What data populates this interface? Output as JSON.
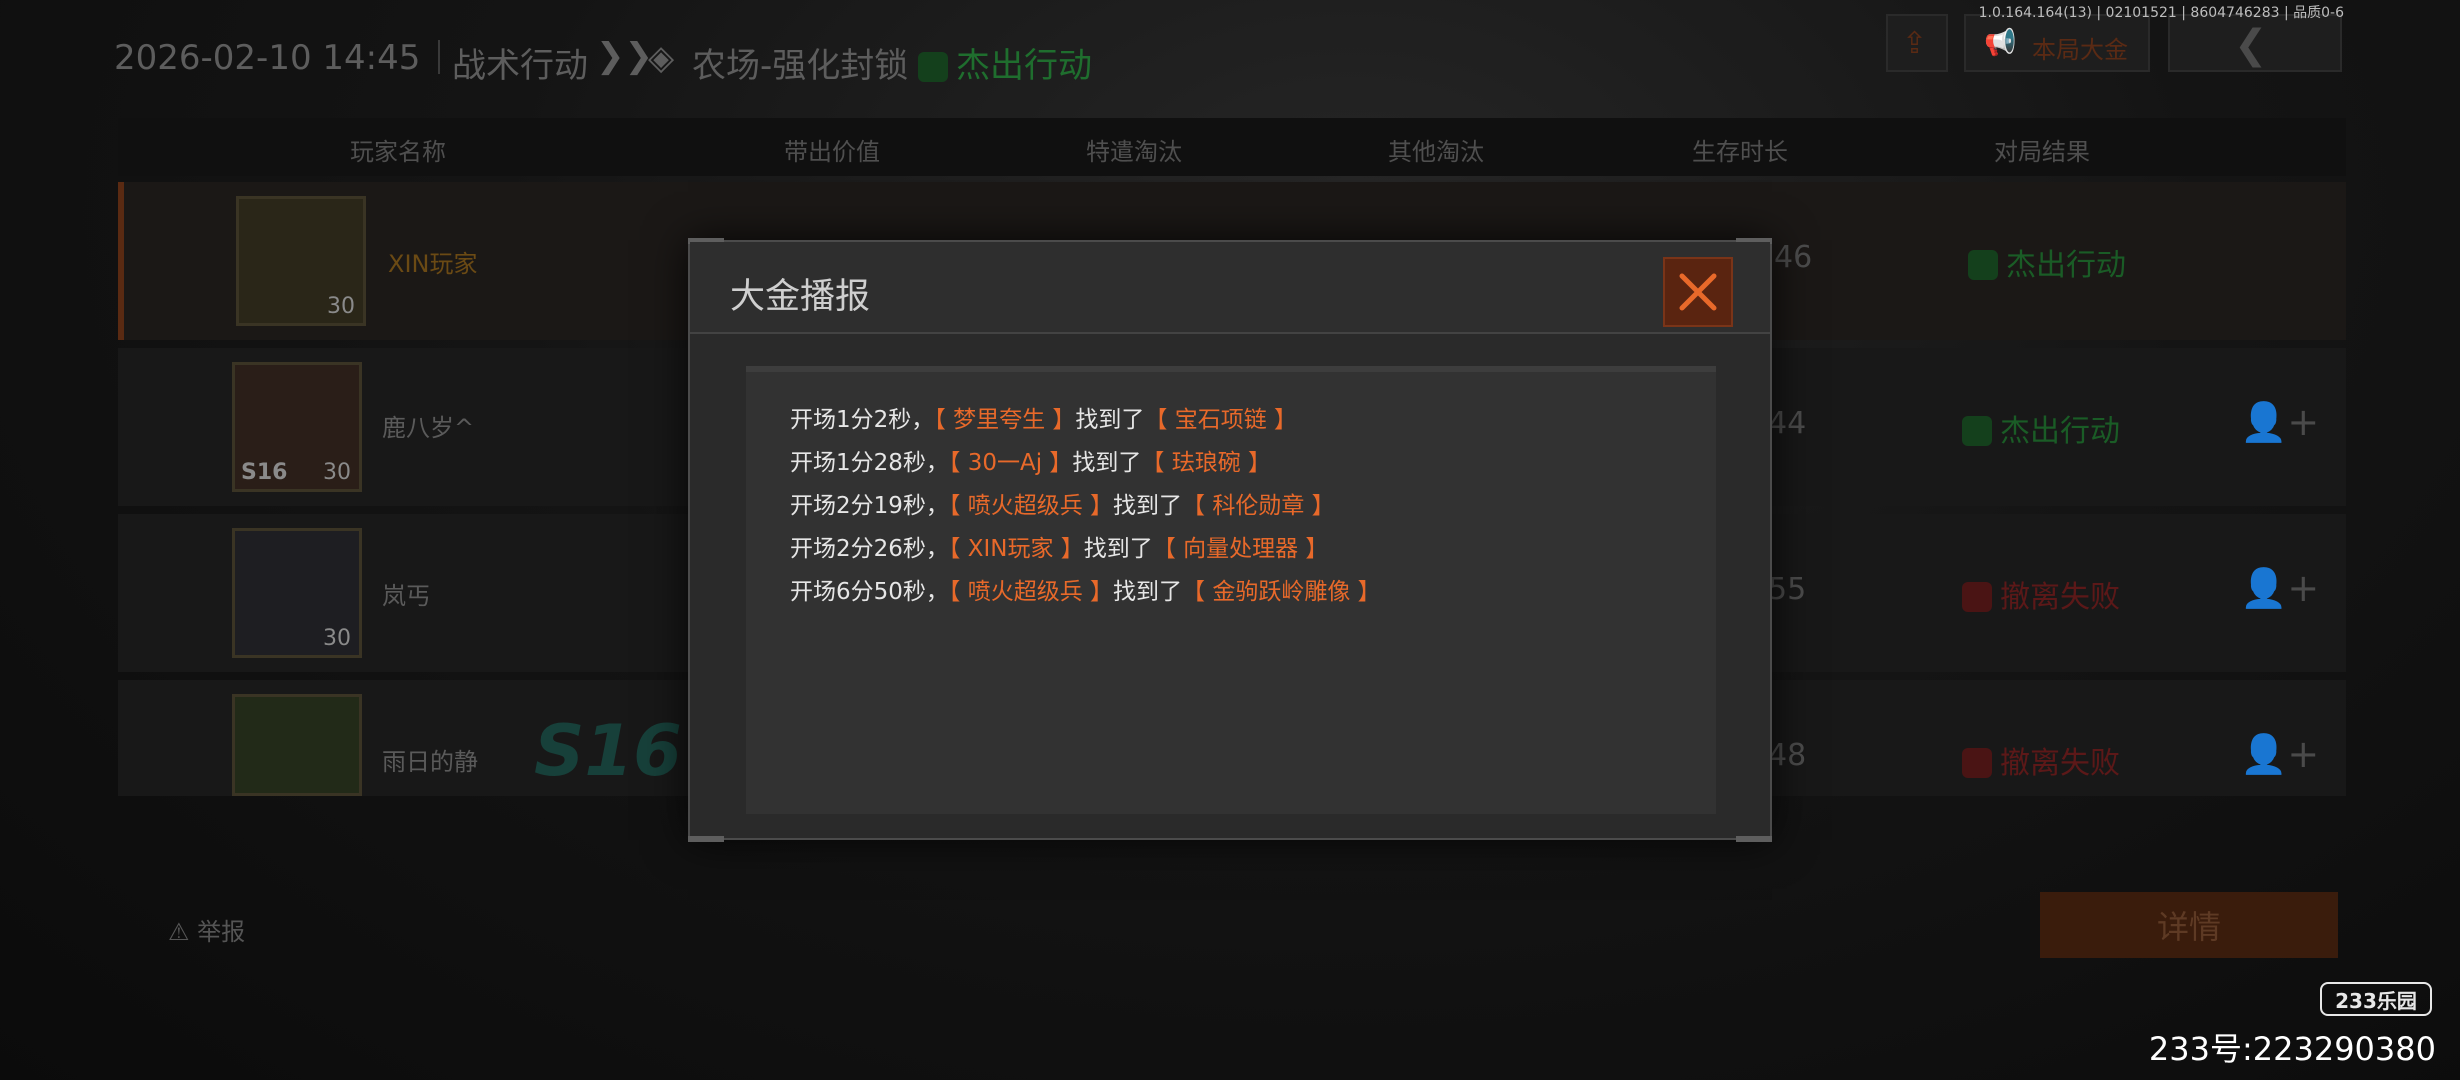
{
  "header": {
    "datetime": "2026-02-10 14:45",
    "mode": "战术行动",
    "map": "农场-强化封锁",
    "outcome": "杰出行动",
    "round_gold_label": "本局大金"
  },
  "table": {
    "columns": [
      "玩家名称",
      "带出价值",
      "特遣淘汰",
      "其他淘汰",
      "生存时长",
      "对局结果"
    ],
    "rows": [
      {
        "name": "XIN玩家",
        "level": "30",
        "time_suffix": "46",
        "result": "杰出行动",
        "result_type": "ok"
      },
      {
        "name": "鹿八岁^",
        "level": "30",
        "badge": "S16",
        "time_suffix": "44",
        "result": "杰出行动",
        "result_type": "ok"
      },
      {
        "name": "岚丐",
        "level": "30",
        "time_suffix": "55",
        "result": "撤离失败",
        "result_type": "fail"
      },
      {
        "name": "雨日的静",
        "level": "",
        "badge": "S16",
        "time_suffix": "48",
        "result": "撤离失败",
        "result_type": "fail"
      }
    ]
  },
  "footer": {
    "report_label": "举报",
    "details_label": "详情"
  },
  "modal": {
    "title": "大金播报",
    "close_icon": "close-x-icon",
    "entries": [
      {
        "time": "开场1分2秒，",
        "player": "【 梦里夸生 】",
        "verb": "找到了",
        "item": "【 宝石项链 】"
      },
      {
        "time": "开场1分28秒，",
        "player": "【 30一Aj 】",
        "verb": "找到了",
        "item": "【 珐琅碗 】"
      },
      {
        "time": "开场2分19秒，",
        "player": "【 喷火超级兵 】",
        "verb": "找到了",
        "item": "【 科伦勋章 】"
      },
      {
        "time": "开场2分26秒，",
        "player": "【 XIN玩家 】",
        "verb": "找到了",
        "item": "【 向量处理器 】"
      },
      {
        "time": "开场6分50秒，",
        "player": "【 喷火超级兵 】",
        "verb": "找到了",
        "item": "【 金驹跃岭雕像 】"
      }
    ]
  },
  "overlay": {
    "version": "1.0.164.164(13) | 02101521 | 8604746283 | 品质0-6",
    "watermark_logo": "233乐园",
    "watermark_id": "233号:223290380"
  },
  "colors": {
    "highlight": "#e8692a",
    "close_button": "#5a2410",
    "modal_bg": "#2a2a2a"
  }
}
